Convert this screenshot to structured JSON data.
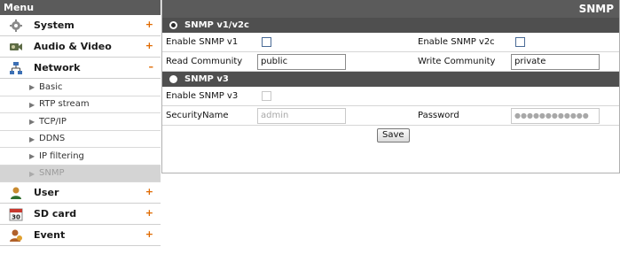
{
  "menu": {
    "header": "Menu",
    "items": [
      {
        "label": "System",
        "icon": "gear-icon",
        "toggle": "+"
      },
      {
        "label": "Audio & Video",
        "icon": "video-camera-icon",
        "toggle": "+"
      },
      {
        "label": "Network",
        "icon": "network-icon",
        "toggle": "–"
      }
    ],
    "network_sub": [
      {
        "label": "Basic"
      },
      {
        "label": "RTP stream"
      },
      {
        "label": "TCP/IP"
      },
      {
        "label": "DDNS"
      },
      {
        "label": "IP filtering"
      },
      {
        "label": "SNMP"
      }
    ],
    "items_after": [
      {
        "label": "User",
        "icon": "user-icon",
        "toggle": "+"
      },
      {
        "label": "SD card",
        "icon": "calendar-icon",
        "toggle": "+"
      },
      {
        "label": "Event",
        "icon": "event-icon",
        "toggle": "+"
      }
    ]
  },
  "panel": {
    "title": "SNMP",
    "v1v2c": {
      "section_label": "SNMP v1/v2c",
      "enable_v1_label": "Enable SNMP v1",
      "enable_v2c_label": "Enable  SNMP v2c",
      "read_community_label": "Read Community",
      "read_community_value": "public",
      "write_community_label": "Write Community",
      "write_community_value": "private"
    },
    "v3": {
      "section_label": "SNMP v3",
      "enable_v3_label": "Enable  SNMP v3",
      "security_name_label": "SecurityName",
      "security_name_value": "admin",
      "password_label": "Password",
      "password_value": "●●●●●●●●●●●●"
    },
    "save_label": "Save"
  },
  "colors": {
    "header_bg": "#5b5b5b",
    "section_bg": "#4f4f4f",
    "toggle_orange": "#e06a00",
    "active_sub_bg": "#d4d4d4"
  }
}
